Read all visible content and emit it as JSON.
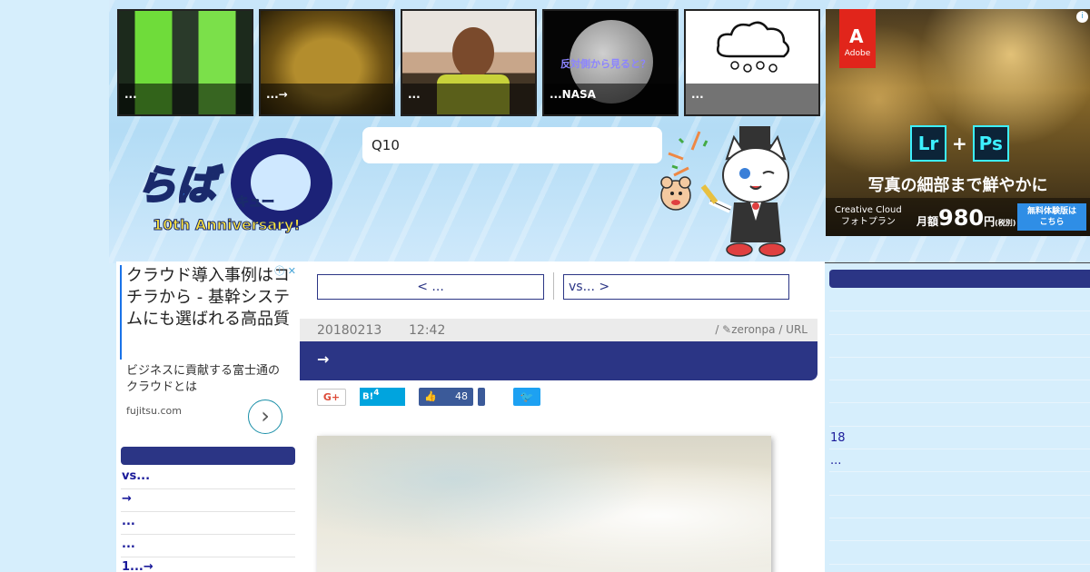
{
  "thumbnails": [
    {
      "caption": "..."
    },
    {
      "caption": "...→"
    },
    {
      "caption": "..."
    },
    {
      "caption": "...NASA",
      "overlay_text": "反対側から見ると？"
    },
    {
      "caption": "..."
    }
  ],
  "logo": {
    "main": "らば",
    "kyu": "キュー",
    "anniversary": "10th Anniversary!"
  },
  "search": {
    "value": "Q10"
  },
  "right_ad": {
    "brand": "Adobe",
    "product_a": "Lr",
    "product_b": "Ps",
    "catch": "写真の細部まで鮮やかに",
    "plan": "Creative Cloud\nフォトプラン",
    "price_prefix": "月額",
    "price": "980",
    "price_suffix": "円",
    "price_note": "(税別)",
    "trial": "無料体験版は\nこちら"
  },
  "left_ad": {
    "title": "クラウド導入事例はコチラから - 基幹システムにも選ばれる高品質",
    "desc": "ビジネスに貢献する富士通のクラウドとは",
    "domain": "fujitsu.com",
    "info_icon": "ⓘ",
    "close_icon": "✕"
  },
  "left_nav": {
    "items": [
      "vs...",
      "→",
      "...",
      "...",
      "1...→"
    ]
  },
  "article": {
    "prev_label": "< ...",
    "next_label": "vs... >",
    "date": "20180213",
    "time": "12:42",
    "author": "/ ✎zeronpa / URL",
    "title": "→",
    "share": {
      "gplus": "G+",
      "hatena": "B!",
      "hatena_count": "4",
      "fb_count": "48"
    }
  },
  "right_col": {
    "items": [
      "",
      "",
      "",
      "",
      "",
      "",
      "18",
      "...",
      "",
      "",
      "",
      ""
    ]
  },
  "colors": {
    "accent": "#2b3585",
    "background": "#d6eefc"
  }
}
